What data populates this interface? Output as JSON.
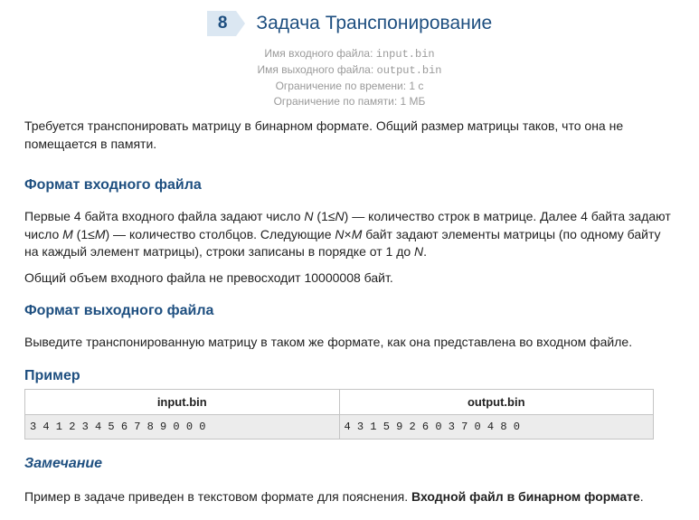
{
  "problem": {
    "number": "8",
    "title": "Задача Транспонирование",
    "limits": {
      "input_label": "Имя входного файла:",
      "input_file": "input.bin",
      "output_label": "Имя выходного файла:",
      "output_file": "output.bin",
      "time": "Ограничение по времени: 1 с",
      "memory": "Ограничение по памяти: 1 МБ"
    }
  },
  "statement": "Требуется транспонировать матрицу в бинарном формате. Общий размер матрицы таков, что она не помещается в памяти.",
  "input_section": {
    "heading": "Формат входного файла",
    "p1": {
      "t1": "Первые 4 байта входного файла задают число ",
      "v1": "N",
      "t2": " (1≤",
      "v2": "N",
      "t3": ") — количество строк в матрице. Далее 4 байта задают число ",
      "v3": "M",
      "t4": " (1≤",
      "v4": "M",
      "t5": ") — количество столбцов. Следующие ",
      "v5": "N",
      "t6": "×",
      "v6": "M",
      "t7": " байт задают элементы матрицы (по одному байту на каждый элемент матрицы), строки записаны в порядке от 1 до ",
      "v7": "N",
      "t8": "."
    },
    "p2": "Общий объем входного файла не превосходит 10000008 байт."
  },
  "output_section": {
    "heading": "Формат выходного файла",
    "text": "Выведите транспонированную матрицу в таком же формате, как она представлена во входном файле."
  },
  "example": {
    "heading": "Пример",
    "columns": [
      "input.bin",
      "output.bin"
    ],
    "rows": [
      [
        "3 4 1 2 3 4 5 6 7 8 9 0 0 0",
        "4 3 1 5 9 2 6 0 3 7 0 4 8 0"
      ]
    ]
  },
  "note": {
    "heading": "Замечание",
    "text": "Пример в задаче приведен в текстовом формате для пояснения. ",
    "bold": "Входной файл в бинарном формате",
    "end": "."
  }
}
